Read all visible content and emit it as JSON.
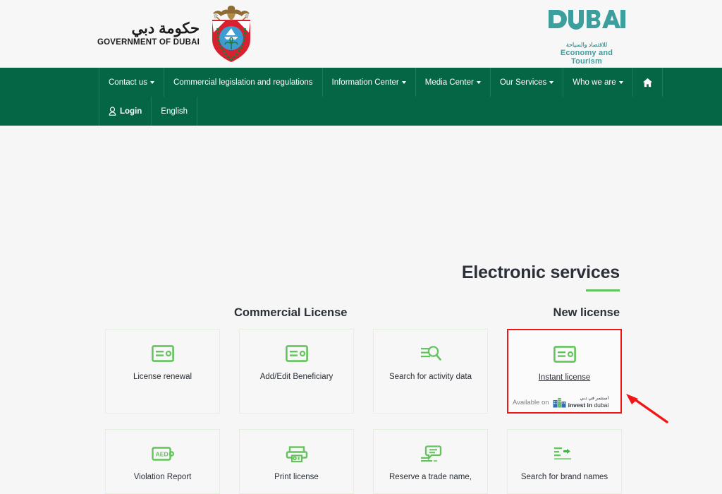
{
  "header": {
    "gov_logo": {
      "arabic": "حكومة دبي",
      "english": "GOVERNMENT OF DUBAI",
      "emblem_icon": "dubai-emblem-icon"
    },
    "det_logo": {
      "wordmark": "DUBAI",
      "arabic": "للاقتصاد والسياحة",
      "english": "Economy and Tourism",
      "color": "#3c9f9e"
    }
  },
  "nav": {
    "background": "#056645",
    "primary_items": [
      {
        "label": "Contact us",
        "has_dropdown": true
      },
      {
        "label": "Commercial legislation and regulations",
        "has_dropdown": false
      },
      {
        "label": "Information Center",
        "has_dropdown": true
      },
      {
        "label": "Media Center",
        "has_dropdown": true
      },
      {
        "label": "Our Services",
        "has_dropdown": true
      },
      {
        "label": "Who we are",
        "has_dropdown": true
      }
    ],
    "home_icon": "home-icon",
    "secondary_items": [
      {
        "label": "Login",
        "icon": "user-icon"
      },
      {
        "label": "English",
        "icon": null
      }
    ]
  },
  "main": {
    "page_title": "Electronic services",
    "accent_color": "#64c35c",
    "sections": {
      "commercial_license": "Commercial License",
      "new_license": "New license"
    },
    "cards_row1": [
      {
        "label": "License renewal",
        "icon": "id-card-icon",
        "highlighted": false
      },
      {
        "label": "Add/Edit Beneficiary",
        "icon": "id-card-icon",
        "highlighted": false
      },
      {
        "label": "Search for activity data",
        "icon": "search-lines-icon",
        "highlighted": false
      },
      {
        "label": "Instant license",
        "icon": "id-card-icon",
        "highlighted": true,
        "badge": {
          "available_text": "Available on",
          "brand_arabic": "استثمر في دبي",
          "brand_english_bold": "invest in",
          "brand_english_rest": "dubai",
          "brand_icon": "invest-in-dubai-buildings-icon"
        }
      }
    ],
    "cards_row2": [
      {
        "label": "Violation Report",
        "icon": "aed-wallet-icon"
      },
      {
        "label": "Print license",
        "icon": "printer-icon"
      },
      {
        "label": "Reserve a trade name,",
        "icon": "speech-bubble-lines-icon"
      },
      {
        "label": "Search for brand names",
        "icon": "lines-arrow-icon"
      }
    ]
  },
  "annotation": {
    "arrow_color": "#f41414",
    "highlight_color": "#f41414"
  }
}
